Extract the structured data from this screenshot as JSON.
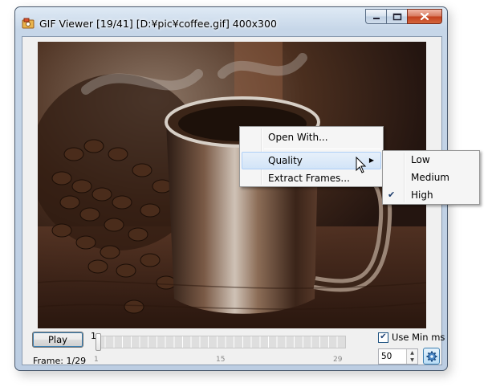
{
  "window": {
    "title": "GIF Viewer [19/41] [D:¥pic¥coffee.gif] 400x300"
  },
  "controls": {
    "play_label": "Play",
    "frame_label": "Frame: 1/29",
    "slider": {
      "value_label": "1",
      "current": 1,
      "total": 29,
      "ticks": [
        "1",
        "15",
        "29"
      ]
    },
    "use_min_ms": {
      "label": "Use Min ms",
      "checked": true
    },
    "min_ms_value": "50"
  },
  "context_menu": {
    "items": [
      {
        "label": "Open With..."
      },
      {
        "label": "Quality",
        "has_submenu": true,
        "highlighted": true
      },
      {
        "label": "Extract Frames..."
      }
    ]
  },
  "quality_submenu": {
    "items": [
      {
        "label": "Low",
        "checked": false
      },
      {
        "label": "Medium",
        "checked": false
      },
      {
        "label": "High",
        "checked": true
      }
    ]
  },
  "colors": {
    "menu_highlight": "#d2e4f7",
    "title_bar": "#c6d6e8",
    "close_button": "#c2401d"
  }
}
